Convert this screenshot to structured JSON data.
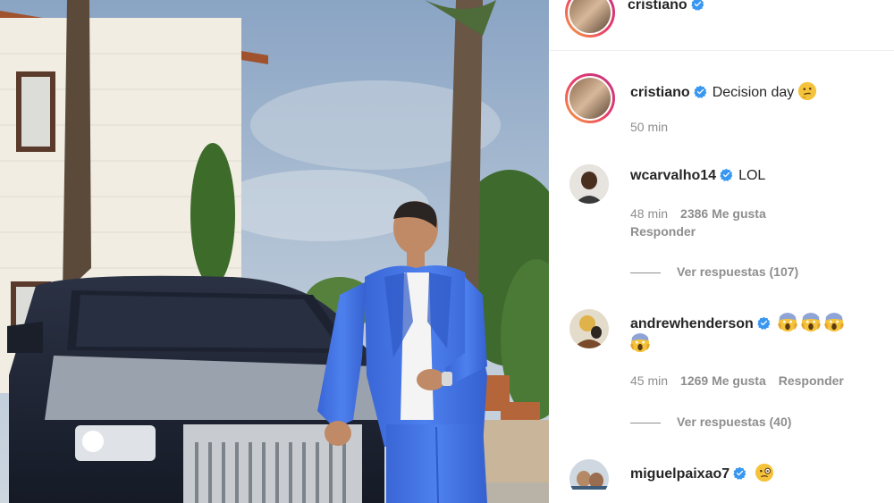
{
  "header": {
    "username": "cristiano",
    "verified": true
  },
  "caption": {
    "username": "cristiano",
    "text": "Decision day",
    "emoji": "thinking-face",
    "time": "50 min"
  },
  "comments": [
    {
      "username": "wcarvalho14",
      "text": "LOL",
      "time": "48 min",
      "likes": "2386 Me gusta",
      "reply": "Responder",
      "view_replies": "Ver respuestas (107)"
    },
    {
      "username": "andrewhenderson",
      "emoji": "screaming-face",
      "emoji_count": 4,
      "time": "45 min",
      "likes": "1269 Me gusta",
      "reply": "Responder",
      "view_replies": "Ver respuestas (40)"
    },
    {
      "username": "miguelpaixao7",
      "emoji": "face-with-monocle"
    }
  ],
  "colors": {
    "verified_blue": "#3897f0",
    "suit_blue": "#3b6fe0",
    "text_gray": "#8e8e8e"
  }
}
